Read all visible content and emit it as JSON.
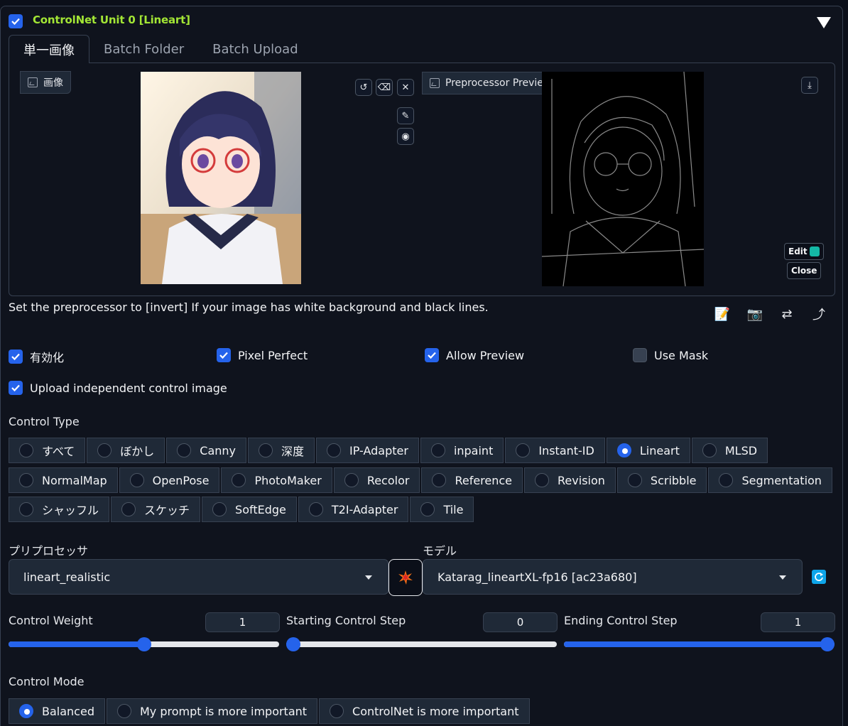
{
  "header": {
    "title": "ControlNet Unit 0  [Lineart]",
    "enabled": true
  },
  "tabs": [
    "単一画像",
    "Batch Folder",
    "Batch Upload"
  ],
  "image_panel": {
    "input_label": "画像",
    "preview_label": "Preprocessor Preview",
    "edit_label": "Edit",
    "close_label": "Close"
  },
  "hint": "Set the preprocessor to [invert] If your image has white background and black lines.",
  "toggles": [
    {
      "label": "有効化",
      "checked": true
    },
    {
      "label": "Pixel Perfect",
      "checked": true
    },
    {
      "label": "Allow Preview",
      "checked": true
    },
    {
      "label": "Use Mask",
      "checked": false
    },
    {
      "label": "Upload independent control image",
      "checked": true
    }
  ],
  "control_type": {
    "label": "Control Type",
    "rows": [
      [
        "すべて",
        "ぼかし",
        "Canny",
        "深度",
        "IP-Adapter",
        "inpaint",
        "Instant-ID",
        "Lineart",
        "MLSD"
      ],
      [
        "NormalMap",
        "OpenPose",
        "PhotoMaker",
        "Recolor",
        "Reference",
        "Revision",
        "Scribble",
        "Segmentation"
      ],
      [
        "シャッフル",
        "スケッチ",
        "SoftEdge",
        "T2I-Adapter",
        "Tile"
      ]
    ],
    "selected": "Lineart"
  },
  "preprocessor": {
    "label": "プリプロセッサ",
    "value": "lineart_realistic"
  },
  "model": {
    "label": "モデル",
    "value": "Katarag_lineartXL-fp16 [ac23a680]"
  },
  "sliders": [
    {
      "label": "Control Weight",
      "value": "1",
      "fraction": 0.5
    },
    {
      "label": "Starting Control Step",
      "value": "0",
      "fraction": 0.0
    },
    {
      "label": "Ending Control Step",
      "value": "1",
      "fraction": 1.0
    }
  ],
  "control_mode": {
    "label": "Control Mode",
    "options": [
      "Balanced",
      "My prompt is more important",
      "ControlNet is more important"
    ],
    "selected": "Balanced"
  }
}
